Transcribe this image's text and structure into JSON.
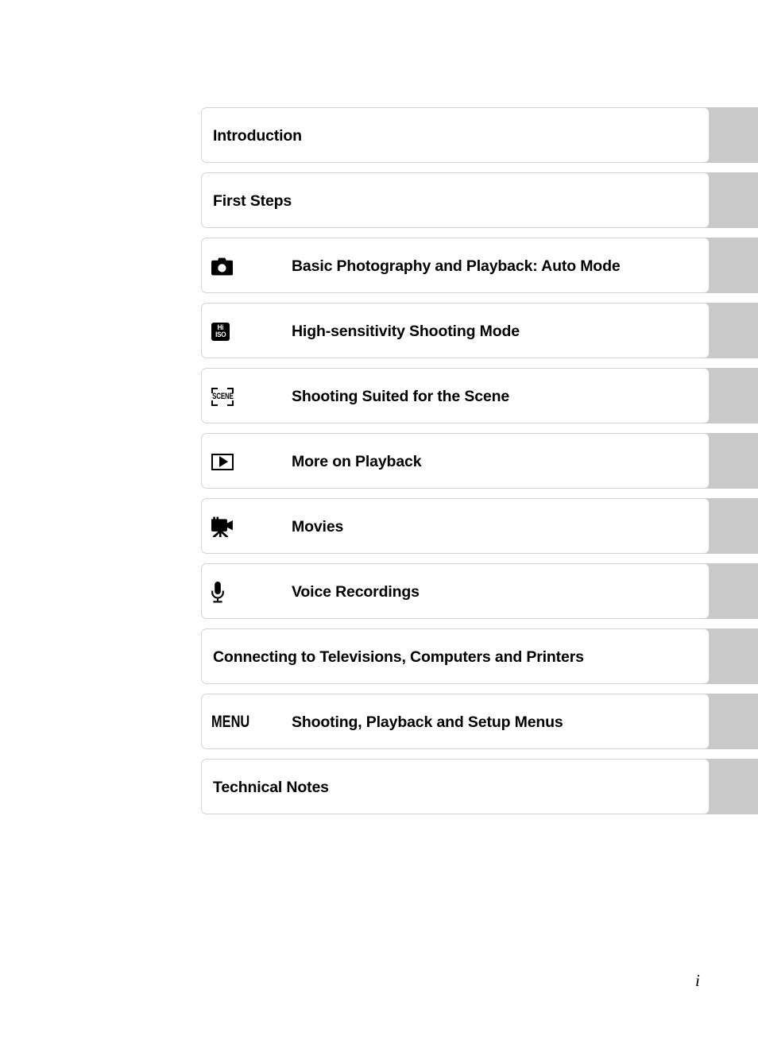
{
  "document": {
    "page_number": "i",
    "type": "table-of-contents"
  },
  "chapters": [
    {
      "icon": "none",
      "title": "Introduction"
    },
    {
      "icon": "none",
      "title": "First Steps"
    },
    {
      "icon": "camera-icon",
      "title": "Basic Photography and Playback: Auto Mode"
    },
    {
      "icon": "hi-iso-icon",
      "title": "High-sensitivity Shooting Mode",
      "icon_text_top": "Hi",
      "icon_text_bottom": "ISO"
    },
    {
      "icon": "scene-icon",
      "title": "Shooting Suited for the Scene",
      "icon_text": "SCENE"
    },
    {
      "icon": "playback-icon",
      "title": "More on Playback"
    },
    {
      "icon": "movie-camera-icon",
      "title": "Movies"
    },
    {
      "icon": "microphone-icon",
      "title": "Voice Recordings"
    },
    {
      "icon": "none",
      "title": "Connecting to Televisions, Computers and Printers"
    },
    {
      "icon": "menu-icon",
      "title": "Shooting, Playback and Setup Menus",
      "icon_text": "MENU"
    },
    {
      "icon": "none",
      "title": "Technical Notes"
    }
  ],
  "colors": {
    "tab_gray": "#c9c9c9",
    "card_border": "#d2d2d2",
    "text": "#000000",
    "page_background": "#ffffff"
  }
}
